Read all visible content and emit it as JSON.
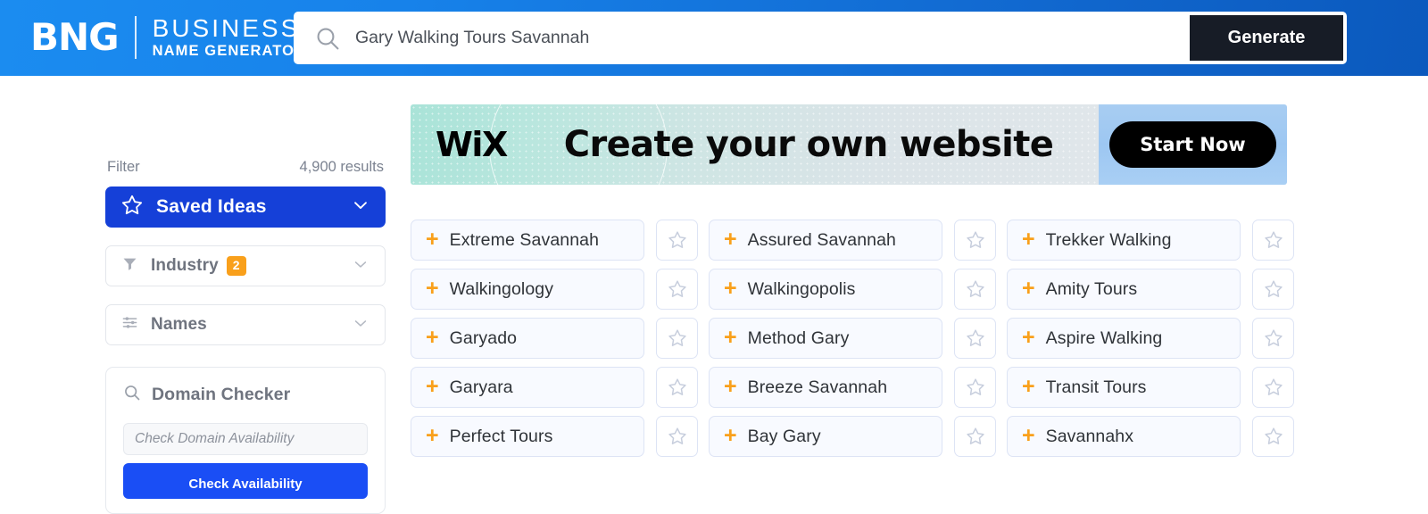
{
  "header": {
    "logo_main": "BNG",
    "logo_line1": "BUSINESS",
    "logo_line2": "NAME GENERATOR",
    "search_value": "Gary Walking Tours Savannah",
    "search_placeholder": "Gary Walking Tours Savannah",
    "generate_label": "Generate",
    "gradient_from": "#1b8cf0",
    "gradient_to": "#0b59bd"
  },
  "sidebar": {
    "filter_label": "Filter",
    "results_count": "4,900 results",
    "saved_ideas": {
      "label": "Saved Ideas",
      "icon": "star-icon",
      "chevron": "chevron-down-icon",
      "color": "#1540d8"
    },
    "filters": [
      {
        "label": "Industry",
        "icon": "funnel-icon",
        "badge": "2",
        "badge_color": "#f9a01b"
      },
      {
        "label": "Names",
        "icon": "sliders-icon",
        "badge": null
      }
    ],
    "domain_checker": {
      "title": "Domain Checker",
      "icon": "search-icon",
      "input_value": "",
      "input_placeholder": "Check Domain Availability",
      "button_label": "Check Availability",
      "button_color": "#1a4ef5"
    }
  },
  "banner": {
    "brand": "WiX",
    "tagline": "Create your own  website",
    "cta_label": "Start Now"
  },
  "results": {
    "columns": [
      [
        {
          "name": "Extreme Savannah"
        },
        {
          "name": "Walkingology"
        },
        {
          "name": "Garyado"
        },
        {
          "name": "Garyara"
        },
        {
          "name": "Perfect Tours"
        }
      ],
      [
        {
          "name": "Assured Savannah"
        },
        {
          "name": "Walkingopolis"
        },
        {
          "name": "Method Gary"
        },
        {
          "name": "Breeze Savannah"
        },
        {
          "name": "Bay Gary"
        }
      ],
      [
        {
          "name": "Trekker Walking"
        },
        {
          "name": "Amity Tours"
        },
        {
          "name": "Aspire Walking"
        },
        {
          "name": "Transit Tours"
        },
        {
          "name": "Savannahx"
        }
      ]
    ],
    "add_icon": "plus-icon",
    "save_icon": "star-outline-icon",
    "plus_color": "#f9a01b"
  }
}
